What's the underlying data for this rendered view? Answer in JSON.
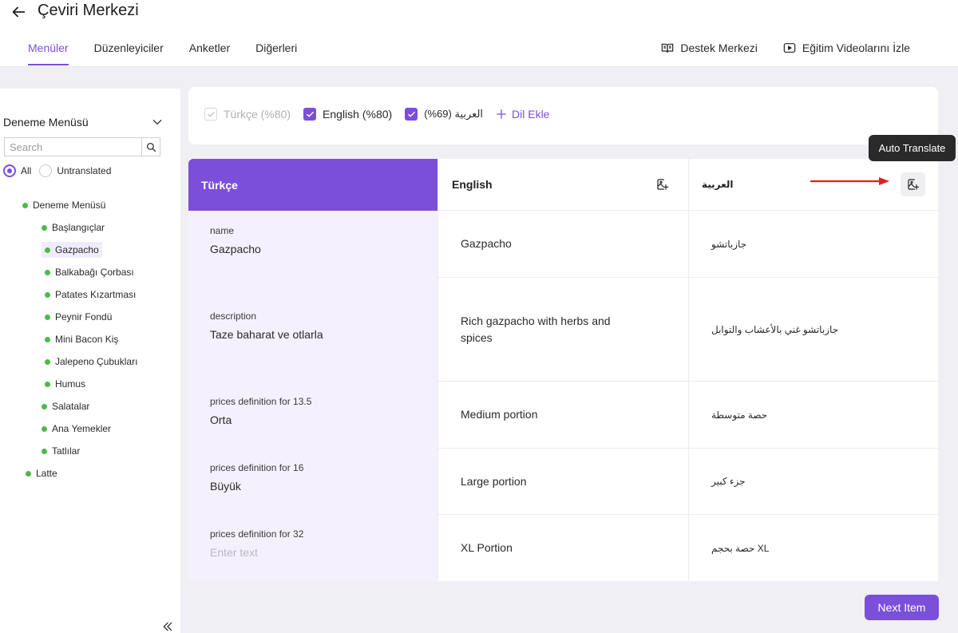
{
  "header": {
    "title": "Çeviri Merkezi",
    "tabs": [
      {
        "label": "Menüler",
        "active": true
      },
      {
        "label": "Düzenleyiciler",
        "active": false
      },
      {
        "label": "Anketler",
        "active": false
      },
      {
        "label": "Diğerleri",
        "active": false
      }
    ],
    "links": {
      "support": "Destek Merkezi",
      "videos": "Eğitim Videolarını İzle"
    }
  },
  "sidebar": {
    "menu_name": "Deneme Menüsü",
    "search_placeholder": "Search",
    "filters": {
      "all": "All",
      "untranslated": "Untranslated",
      "selected": "all"
    },
    "tree": [
      {
        "label": "Deneme Menüsü",
        "level": 0
      },
      {
        "label": "Başlangıçlar",
        "level": 1
      },
      {
        "label": "Gazpacho",
        "level": 2,
        "selected": true
      },
      {
        "label": "Balkabağı Çorbası",
        "level": 2
      },
      {
        "label": "Patates Kızartması",
        "level": 2
      },
      {
        "label": "Peynir Fondü",
        "level": 2
      },
      {
        "label": "Mini Bacon Kiş",
        "level": 2
      },
      {
        "label": "Jalepeno Çubukları",
        "level": 2
      },
      {
        "label": "Humus",
        "level": 2
      },
      {
        "label": "Salatalar",
        "level": 1
      },
      {
        "label": "Ana Yemekler",
        "level": 1
      },
      {
        "label": "Tatlılar",
        "level": 1
      },
      {
        "label": "Latte",
        "level": 0
      }
    ]
  },
  "languages": {
    "items": [
      {
        "label": "Türkçe (%80)",
        "checked": true,
        "disabled": true
      },
      {
        "label": "English (%80)",
        "checked": true,
        "disabled": false
      },
      {
        "label": "العربية (69%)",
        "checked": true,
        "disabled": false
      }
    ],
    "add_label": "Dil Ekle"
  },
  "grid": {
    "headers": {
      "source": "Türkçe",
      "english": "English",
      "arabic": "العربية"
    },
    "rows": [
      {
        "field": "name",
        "source": "Gazpacho",
        "source_is_placeholder": false,
        "english": "Gazpacho",
        "arabic": "جازباتشو"
      },
      {
        "field": "description",
        "source": "Taze baharat ve otlarla",
        "source_is_placeholder": false,
        "english": "Rich gazpacho with herbs and spices",
        "arabic": "جازباتشو غني بالأعشاب والتوابل"
      },
      {
        "field": "prices definition for 13.5",
        "source": "Orta",
        "source_is_placeholder": false,
        "english": "Medium portion",
        "arabic": "حصة متوسطة"
      },
      {
        "field": "prices definition for 16",
        "source": "Büyük",
        "source_is_placeholder": false,
        "english": "Large portion",
        "arabic": "جزء كبير"
      },
      {
        "field": "prices definition for 32",
        "source": "Enter text",
        "source_is_placeholder": true,
        "english": "XL Portion",
        "arabic": "حصة بحجم XL"
      }
    ]
  },
  "tooltip": "Auto Translate",
  "next_button": "Next Item",
  "colors": {
    "accent": "#7b4fd9",
    "source_column_bg": "#f5f0fd",
    "bullet": "#4fb84a",
    "annotation_arrow": "#e02020"
  }
}
